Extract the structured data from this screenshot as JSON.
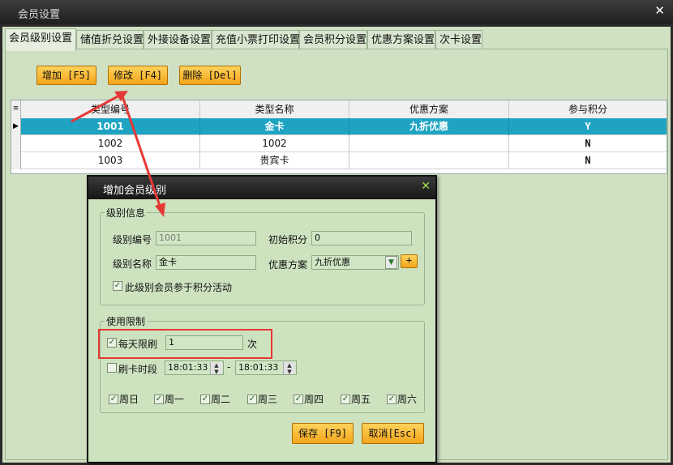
{
  "window": {
    "title": "会员设置",
    "close_icon": "close-icon"
  },
  "tabs": [
    {
      "label": "会员级别设置",
      "active": true
    },
    {
      "label": "储值折兑设置"
    },
    {
      "label": "外接设备设置"
    },
    {
      "label": "充值小票打印设置"
    },
    {
      "label": "会员积分设置"
    },
    {
      "label": "优惠方案设置"
    },
    {
      "label": "次卡设置"
    }
  ],
  "toolbar": {
    "add_label": "增加 [F5]",
    "edit_label": "修改 [F4]",
    "delete_label": "删除 [Del]"
  },
  "grid": {
    "columns": [
      "类型编号",
      "类型名称",
      "优惠方案",
      "参与积分"
    ],
    "rows": [
      {
        "code": "1001",
        "name": "金卡",
        "plan": "九折优惠",
        "points": "Y",
        "selected": true
      },
      {
        "code": "1002",
        "name": "1002",
        "plan": "",
        "points": "N"
      },
      {
        "code": "1003",
        "name": "贵宾卡",
        "plan": "",
        "points": "N"
      }
    ]
  },
  "dialog": {
    "title": "增加会员级别",
    "level_info": {
      "legend": "级别信息",
      "code_label": "级别编号",
      "code_value": "1001",
      "initial_points_label": "初始积分",
      "initial_points_value": "0",
      "name_label": "级别名称",
      "name_value": "金卡",
      "plan_label": "优惠方案",
      "plan_value": "九折优惠",
      "plan_add_label": "+",
      "join_points_label": "此级别会员参于积分活动",
      "join_points_checked": true
    },
    "limits": {
      "legend": "使用限制",
      "daily_limit_label": "每天限刷",
      "daily_limit_checked": true,
      "daily_limit_value": "1",
      "daily_limit_unit": "次",
      "time_label": "刷卡时段",
      "time_checked": false,
      "time_start": "18:01:33",
      "time_sep": "-",
      "time_end": "18:01:33",
      "days": [
        {
          "label": "周日",
          "checked": true
        },
        {
          "label": "周一",
          "checked": true
        },
        {
          "label": "周二",
          "checked": true
        },
        {
          "label": "周三",
          "checked": true
        },
        {
          "label": "周四",
          "checked": true
        },
        {
          "label": "周五",
          "checked": true
        },
        {
          "label": "周六",
          "checked": true
        }
      ]
    },
    "save_label": "保存 [F9]",
    "cancel_label": "取消[Esc]"
  },
  "colors": {
    "accent_button": "#f3a51b",
    "selected_row": "#1ea4c2",
    "annotation": "#e53935"
  }
}
